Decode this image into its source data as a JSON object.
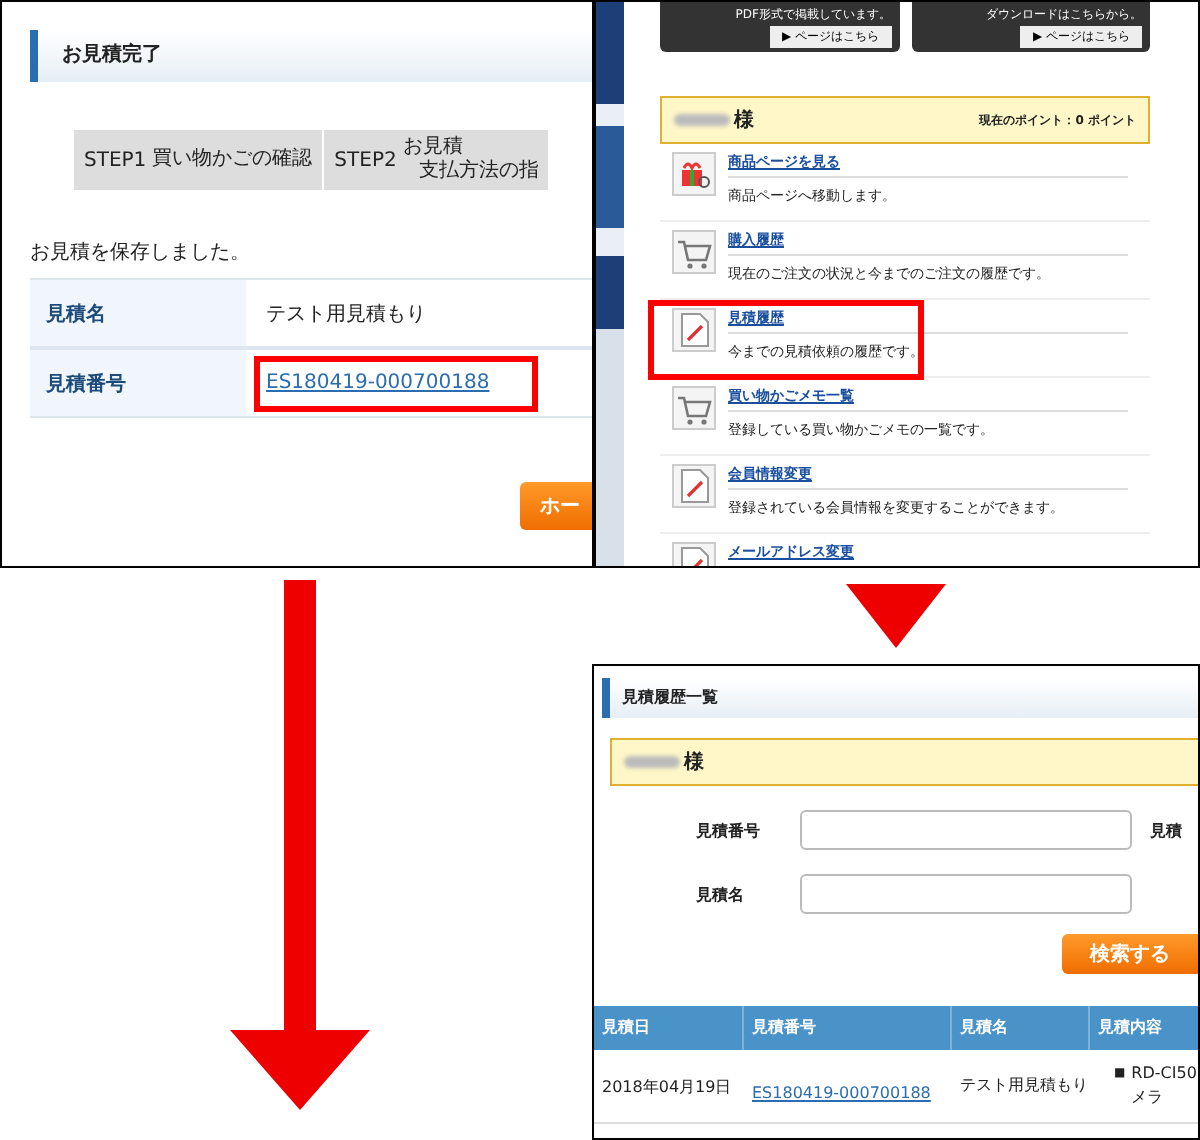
{
  "quote_complete": {
    "title": "お見積完了",
    "steps": [
      {
        "label": "STEP1",
        "lines": [
          "買い物かごの確認"
        ]
      },
      {
        "label": "STEP2",
        "lines": [
          "お見積",
          "支払方法の指"
        ]
      }
    ],
    "message": "お見積を保存しました。",
    "rows": [
      {
        "label": "見積名",
        "value": "テスト用見積もり",
        "kind": "text",
        "highlighted": false
      },
      {
        "label": "見積番号",
        "value": "ES180419-000700188",
        "kind": "link",
        "highlighted": true
      }
    ],
    "button": "ホー"
  },
  "mypage": {
    "banners": [
      {
        "caption": "PDF形式で掲載しています。",
        "button": "▶ ページはこちら"
      },
      {
        "caption": "ダウンロードはこちらから。",
        "button": "▶ ページはこちら"
      }
    ],
    "user_suffix": "様",
    "points": "現在のポイント：0 ポイント",
    "menu": [
      {
        "kind": "gift",
        "title": "商品ページを見る",
        "desc": "商品ページへ移動します。",
        "highlighted": false
      },
      {
        "kind": "cart",
        "title": "購入履歴",
        "desc": "現在のご注文の状況と今までのご注文の履歴です。",
        "highlighted": false
      },
      {
        "kind": "note",
        "title": "見積履歴",
        "desc": "今までの見積依頼の履歴です。",
        "highlighted": true
      },
      {
        "kind": "cart",
        "title": "買い物かごメモ一覧",
        "desc": "登録している買い物かごメモの一覧です。",
        "highlighted": false
      },
      {
        "kind": "note",
        "title": "会員情報変更",
        "desc": "登録されている会員情報を変更することができます。",
        "highlighted": false
      },
      {
        "kind": "note",
        "title": "メールアドレス変更",
        "highlighted": false
      }
    ]
  },
  "history": {
    "title": "見積履歴一覧",
    "user_suffix": "様",
    "fields": [
      {
        "label": "見積番号"
      },
      {
        "label": "見積名"
      }
    ],
    "side_label": "見積",
    "search_button": "検索する",
    "table": {
      "columns": [
        "見積日",
        "見積番号",
        "見積名",
        "見積内容"
      ],
      "rows": [
        {
          "date": "2018年04月19日",
          "number": "ES180419-000700188",
          "name": "テスト用見積もり",
          "bullet": "■",
          "content": [
            "RD-CI50",
            "メラ"
          ]
        }
      ]
    }
  }
}
